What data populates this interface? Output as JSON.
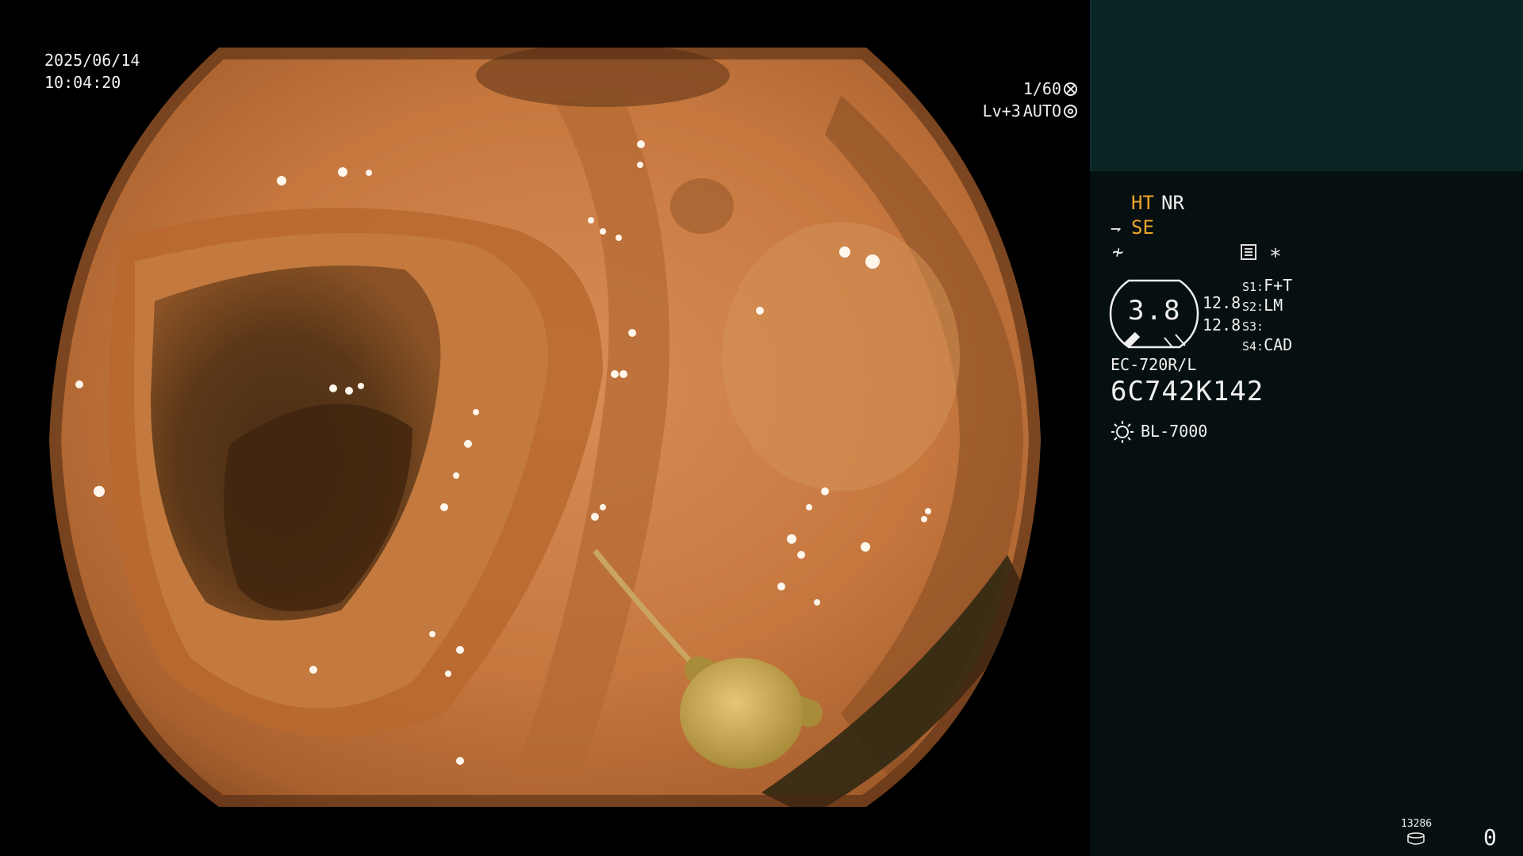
{
  "overlay": {
    "date": "2025/06/14",
    "time": "10:04:20",
    "shutter_speed": "1/60",
    "shutter_icon": "shutter-icon",
    "iris_level": "Lv+3",
    "iris_mode": "AUTO",
    "iris_icon": "iris-icon"
  },
  "panel": {
    "accent_color": "#f1a52c",
    "header_color": "#0a2424",
    "background_color": "#061010",
    "mode_ht": "HT",
    "mode_nr": "NR",
    "se_label": "SE",
    "se_icon": "wand-icon",
    "slash_symbol": "≁",
    "menu_icon": "menu-icon",
    "star": "∗",
    "gauge_value": "3.8",
    "zoom_1": "12.8",
    "zoom_2": "12.8",
    "slots": [
      {
        "key": "S1:",
        "value": "F+T"
      },
      {
        "key": "S2:",
        "value": "LM"
      },
      {
        "key": "S3:",
        "value": ""
      },
      {
        "key": "S4:",
        "value": "CAD"
      }
    ],
    "scope_model": "EC-720R/L",
    "scope_serial": "6C742K142",
    "light_icon": "sun-icon",
    "light_source": "BL-7000",
    "counter_label": "13286",
    "counter_icon": "disk-icon",
    "counter_value": "0"
  }
}
